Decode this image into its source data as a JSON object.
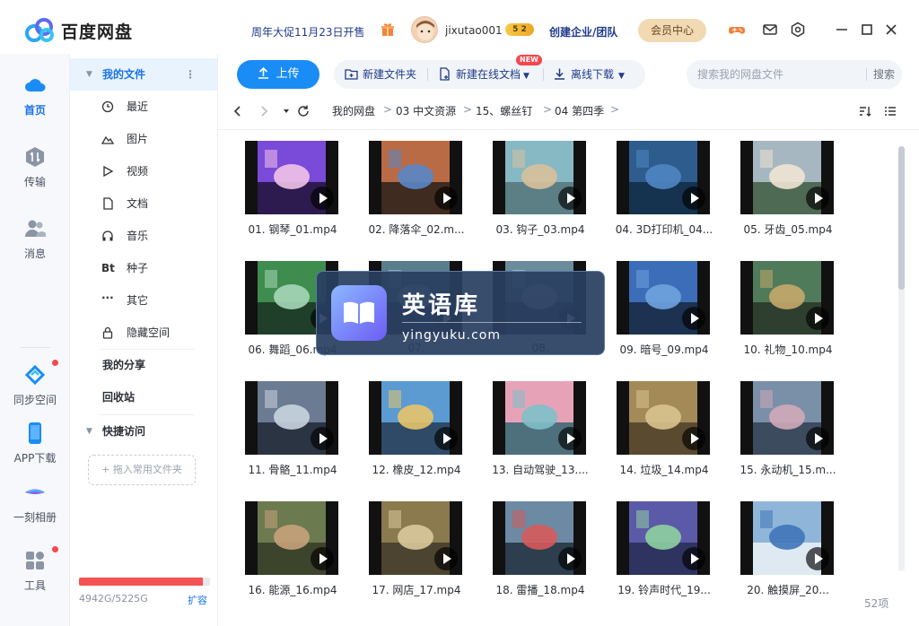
{
  "app": {
    "title": "百度网盘"
  },
  "header": {
    "promo": "周年大促11月23日开售",
    "username": "jixutao001",
    "vip_level": "5 2",
    "enterprise": "创建企业/团队",
    "member_center": "会员中心"
  },
  "rail": {
    "items": [
      {
        "label": "首页"
      },
      {
        "label": "传输"
      },
      {
        "label": "消息"
      },
      {
        "label": "同步空间"
      },
      {
        "label": "APP下载"
      },
      {
        "label": "一刻相册"
      },
      {
        "label": "工具"
      }
    ]
  },
  "sidebar": {
    "my_files": "我的文件",
    "items": [
      {
        "label": "最近"
      },
      {
        "label": "图片"
      },
      {
        "label": "视频"
      },
      {
        "label": "文档"
      },
      {
        "label": "音乐"
      },
      {
        "label": "种子"
      },
      {
        "label": "其它"
      },
      {
        "label": "隐藏空间"
      }
    ],
    "my_share": "我的分享",
    "recycle": "回收站",
    "quick_access": "快捷访问",
    "drop_hint": "+ 拖入常用文件夹",
    "storage_text": "4942G/5225G",
    "storage_used_fraction": 0.946,
    "expand": "扩容"
  },
  "toolbar": {
    "upload": "上传",
    "new_folder": "新建文件夹",
    "new_online_doc": "新建在线文档",
    "new_badge": "NEW",
    "offline_download": "离线下载",
    "search_placeholder": "搜索我的网盘文件",
    "search_button": "搜索"
  },
  "breadcrumb": [
    "我的网盘",
    "03 中文资源",
    "15、螺丝钉",
    "04 第四季"
  ],
  "files": [
    {
      "name": "01. 钢琴_01.mp4"
    },
    {
      "name": "02. 降落伞_02.m..."
    },
    {
      "name": "03. 钩子_03.mp4"
    },
    {
      "name": "04. 3D打印机_04..."
    },
    {
      "name": "05. 牙齿_05.mp4"
    },
    {
      "name": "06. 舞蹈_06.mp4"
    },
    {
      "name": "07."
    },
    {
      "name": "08."
    },
    {
      "name": "09. 暗号_09.mp4"
    },
    {
      "name": "10. 礼物_10.mp4"
    },
    {
      "name": "11. 骨骼_11.mp4"
    },
    {
      "name": "12. 橡皮_12.mp4"
    },
    {
      "name": "13. 自动驾驶_13...."
    },
    {
      "name": "14. 垃圾_14.mp4"
    },
    {
      "name": "15. 永动机_15.m..."
    },
    {
      "name": "16. 能源_16.mp4"
    },
    {
      "name": "17. 网店_17.mp4"
    },
    {
      "name": "18. 雷播_18.mp4"
    },
    {
      "name": "19. 铃声时代_19..."
    },
    {
      "name": "20. 触摸屏_20..."
    }
  ],
  "item_count": "52项",
  "watermark": {
    "title": "英语库",
    "url": "yingyuku.com"
  },
  "colors": {
    "accent": "#1a8cf6",
    "storage": "#f55353",
    "member": "#f1d9b4"
  }
}
